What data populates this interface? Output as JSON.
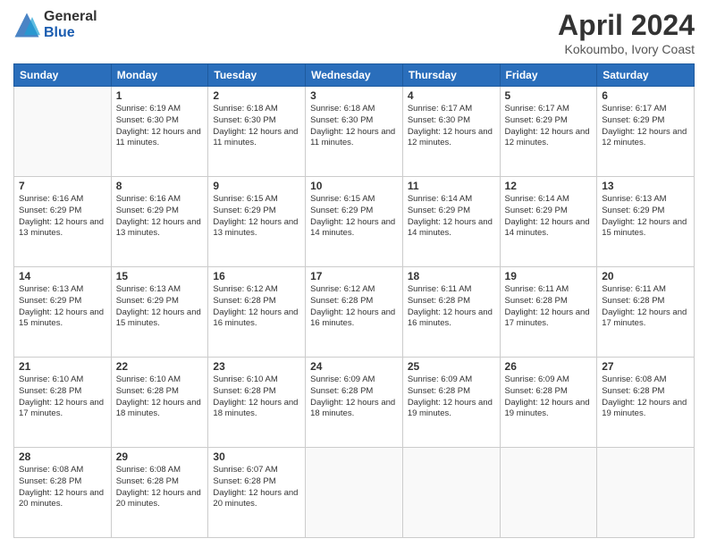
{
  "header": {
    "logo_general": "General",
    "logo_blue": "Blue",
    "title": "April 2024",
    "location": "Kokoumbo, Ivory Coast"
  },
  "days_of_week": [
    "Sunday",
    "Monday",
    "Tuesday",
    "Wednesday",
    "Thursday",
    "Friday",
    "Saturday"
  ],
  "weeks": [
    [
      {
        "day": "",
        "info": ""
      },
      {
        "day": "1",
        "info": "Sunrise: 6:19 AM\nSunset: 6:30 PM\nDaylight: 12 hours\nand 11 minutes."
      },
      {
        "day": "2",
        "info": "Sunrise: 6:18 AM\nSunset: 6:30 PM\nDaylight: 12 hours\nand 11 minutes."
      },
      {
        "day": "3",
        "info": "Sunrise: 6:18 AM\nSunset: 6:30 PM\nDaylight: 12 hours\nand 11 minutes."
      },
      {
        "day": "4",
        "info": "Sunrise: 6:17 AM\nSunset: 6:30 PM\nDaylight: 12 hours\nand 12 minutes."
      },
      {
        "day": "5",
        "info": "Sunrise: 6:17 AM\nSunset: 6:29 PM\nDaylight: 12 hours\nand 12 minutes."
      },
      {
        "day": "6",
        "info": "Sunrise: 6:17 AM\nSunset: 6:29 PM\nDaylight: 12 hours\nand 12 minutes."
      }
    ],
    [
      {
        "day": "7",
        "info": "Sunrise: 6:16 AM\nSunset: 6:29 PM\nDaylight: 12 hours\nand 13 minutes."
      },
      {
        "day": "8",
        "info": "Sunrise: 6:16 AM\nSunset: 6:29 PM\nDaylight: 12 hours\nand 13 minutes."
      },
      {
        "day": "9",
        "info": "Sunrise: 6:15 AM\nSunset: 6:29 PM\nDaylight: 12 hours\nand 13 minutes."
      },
      {
        "day": "10",
        "info": "Sunrise: 6:15 AM\nSunset: 6:29 PM\nDaylight: 12 hours\nand 14 minutes."
      },
      {
        "day": "11",
        "info": "Sunrise: 6:14 AM\nSunset: 6:29 PM\nDaylight: 12 hours\nand 14 minutes."
      },
      {
        "day": "12",
        "info": "Sunrise: 6:14 AM\nSunset: 6:29 PM\nDaylight: 12 hours\nand 14 minutes."
      },
      {
        "day": "13",
        "info": "Sunrise: 6:13 AM\nSunset: 6:29 PM\nDaylight: 12 hours\nand 15 minutes."
      }
    ],
    [
      {
        "day": "14",
        "info": "Sunrise: 6:13 AM\nSunset: 6:29 PM\nDaylight: 12 hours\nand 15 minutes."
      },
      {
        "day": "15",
        "info": "Sunrise: 6:13 AM\nSunset: 6:29 PM\nDaylight: 12 hours\nand 15 minutes."
      },
      {
        "day": "16",
        "info": "Sunrise: 6:12 AM\nSunset: 6:28 PM\nDaylight: 12 hours\nand 16 minutes."
      },
      {
        "day": "17",
        "info": "Sunrise: 6:12 AM\nSunset: 6:28 PM\nDaylight: 12 hours\nand 16 minutes."
      },
      {
        "day": "18",
        "info": "Sunrise: 6:11 AM\nSunset: 6:28 PM\nDaylight: 12 hours\nand 16 minutes."
      },
      {
        "day": "19",
        "info": "Sunrise: 6:11 AM\nSunset: 6:28 PM\nDaylight: 12 hours\nand 17 minutes."
      },
      {
        "day": "20",
        "info": "Sunrise: 6:11 AM\nSunset: 6:28 PM\nDaylight: 12 hours\nand 17 minutes."
      }
    ],
    [
      {
        "day": "21",
        "info": "Sunrise: 6:10 AM\nSunset: 6:28 PM\nDaylight: 12 hours\nand 17 minutes."
      },
      {
        "day": "22",
        "info": "Sunrise: 6:10 AM\nSunset: 6:28 PM\nDaylight: 12 hours\nand 18 minutes."
      },
      {
        "day": "23",
        "info": "Sunrise: 6:10 AM\nSunset: 6:28 PM\nDaylight: 12 hours\nand 18 minutes."
      },
      {
        "day": "24",
        "info": "Sunrise: 6:09 AM\nSunset: 6:28 PM\nDaylight: 12 hours\nand 18 minutes."
      },
      {
        "day": "25",
        "info": "Sunrise: 6:09 AM\nSunset: 6:28 PM\nDaylight: 12 hours\nand 19 minutes."
      },
      {
        "day": "26",
        "info": "Sunrise: 6:09 AM\nSunset: 6:28 PM\nDaylight: 12 hours\nand 19 minutes."
      },
      {
        "day": "27",
        "info": "Sunrise: 6:08 AM\nSunset: 6:28 PM\nDaylight: 12 hours\nand 19 minutes."
      }
    ],
    [
      {
        "day": "28",
        "info": "Sunrise: 6:08 AM\nSunset: 6:28 PM\nDaylight: 12 hours\nand 20 minutes."
      },
      {
        "day": "29",
        "info": "Sunrise: 6:08 AM\nSunset: 6:28 PM\nDaylight: 12 hours\nand 20 minutes."
      },
      {
        "day": "30",
        "info": "Sunrise: 6:07 AM\nSunset: 6:28 PM\nDaylight: 12 hours\nand 20 minutes."
      },
      {
        "day": "",
        "info": ""
      },
      {
        "day": "",
        "info": ""
      },
      {
        "day": "",
        "info": ""
      },
      {
        "day": "",
        "info": ""
      }
    ]
  ]
}
